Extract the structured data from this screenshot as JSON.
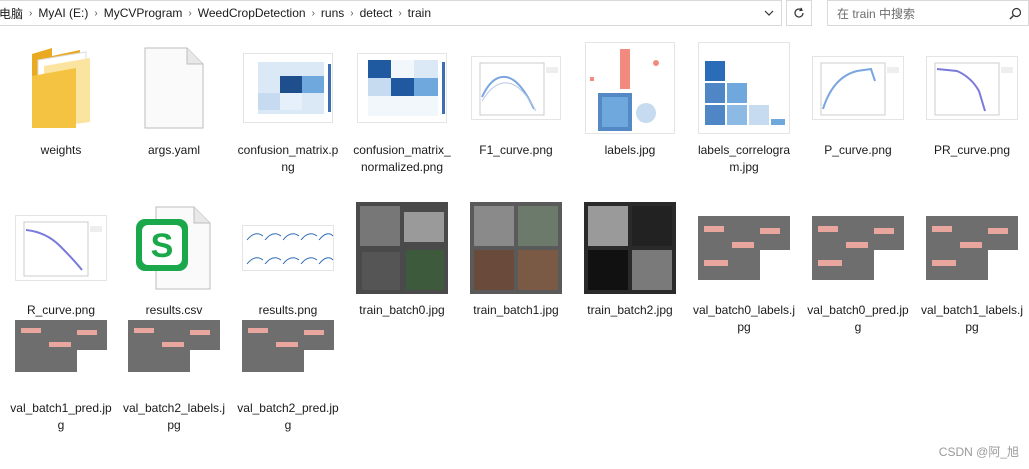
{
  "address_bar": {
    "crumbs": [
      "电脑",
      "MyAI (E:)",
      "MyCVProgram",
      "WeedCropDetection",
      "runs",
      "detect",
      "train"
    ]
  },
  "search": {
    "placeholder": "在 train 中搜索"
  },
  "files": [
    {
      "name": "weights",
      "icon": "folder-icon"
    },
    {
      "name": "args.yaml",
      "icon": "blank-file-icon"
    },
    {
      "name": "confusion_matrix.png",
      "icon": "image-thumbnail"
    },
    {
      "name": "confusion_matrix_normalized.png",
      "icon": "image-thumbnail"
    },
    {
      "name": "F1_curve.png",
      "icon": "image-thumbnail"
    },
    {
      "name": "labels.jpg",
      "icon": "image-thumbnail"
    },
    {
      "name": "labels_correlogram.jpg",
      "icon": "image-thumbnail"
    },
    {
      "name": "P_curve.png",
      "icon": "image-thumbnail"
    },
    {
      "name": "PR_curve.png",
      "icon": "image-thumbnail"
    },
    {
      "name": "R_curve.png",
      "icon": "image-thumbnail"
    },
    {
      "name": "results.csv",
      "icon": "spreadsheet-file-icon"
    },
    {
      "name": "results.png",
      "icon": "image-thumbnail"
    },
    {
      "name": "train_batch0.jpg",
      "icon": "image-thumbnail"
    },
    {
      "name": "train_batch1.jpg",
      "icon": "image-thumbnail"
    },
    {
      "name": "train_batch2.jpg",
      "icon": "image-thumbnail"
    },
    {
      "name": "val_batch0_labels.jpg",
      "icon": "image-thumbnail"
    },
    {
      "name": "val_batch0_pred.jpg",
      "icon": "image-thumbnail"
    },
    {
      "name": "val_batch1_labels.jpg",
      "icon": "image-thumbnail"
    },
    {
      "name": "val_batch1_pred.jpg",
      "icon": "image-thumbnail"
    },
    {
      "name": "val_batch2_labels.jpg",
      "icon": "image-thumbnail"
    },
    {
      "name": "val_batch2_pred.jpg",
      "icon": "image-thumbnail"
    }
  ],
  "watermark": "CSDN @阿_旭",
  "colors": {
    "folder": "#f5c342",
    "spreadsheet": "#1aa84a",
    "heatmap": "#1f5aa0"
  }
}
